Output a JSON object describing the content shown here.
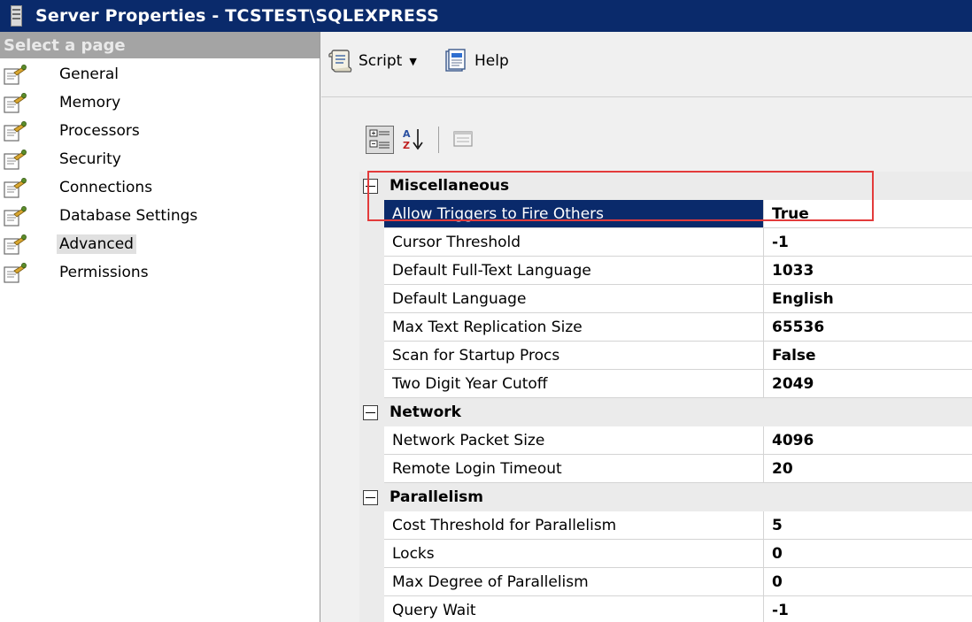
{
  "window": {
    "title": "Server Properties - TCSTEST\\SQLEXPRESS",
    "colors": {
      "titlebar": "#0a2a6b",
      "selection": "#0a2a6b",
      "highlight_box": "#e33b3b"
    }
  },
  "sidebar": {
    "header": "Select a page",
    "items": [
      {
        "label": "General",
        "icon": "page-icon"
      },
      {
        "label": "Memory",
        "icon": "page-icon"
      },
      {
        "label": "Processors",
        "icon": "page-icon"
      },
      {
        "label": "Security",
        "icon": "page-icon"
      },
      {
        "label": "Connections",
        "icon": "page-icon"
      },
      {
        "label": "Database Settings",
        "icon": "page-icon"
      },
      {
        "label": "Advanced",
        "icon": "page-icon",
        "selected": true
      },
      {
        "label": "Permissions",
        "icon": "page-icon"
      }
    ]
  },
  "toolbar": {
    "script_label": "Script",
    "help_label": "Help"
  },
  "grid": {
    "categories": [
      {
        "name": "Miscellaneous",
        "properties": [
          {
            "name": "Allow Triggers to Fire Others",
            "value": "True",
            "selected": true
          },
          {
            "name": "Cursor Threshold",
            "value": "-1"
          },
          {
            "name": "Default Full-Text Language",
            "value": "1033"
          },
          {
            "name": "Default Language",
            "value": "English"
          },
          {
            "name": "Max Text Replication Size",
            "value": "65536"
          },
          {
            "name": "Scan for Startup Procs",
            "value": "False"
          },
          {
            "name": "Two Digit Year Cutoff",
            "value": "2049"
          }
        ]
      },
      {
        "name": "Network",
        "properties": [
          {
            "name": "Network Packet Size",
            "value": "4096"
          },
          {
            "name": "Remote Login Timeout",
            "value": "20"
          }
        ]
      },
      {
        "name": "Parallelism",
        "properties": [
          {
            "name": "Cost Threshold for Parallelism",
            "value": "5"
          },
          {
            "name": "Locks",
            "value": "0"
          },
          {
            "name": "Max Degree of Parallelism",
            "value": "0"
          },
          {
            "name": "Query Wait",
            "value": "-1"
          }
        ]
      }
    ]
  }
}
